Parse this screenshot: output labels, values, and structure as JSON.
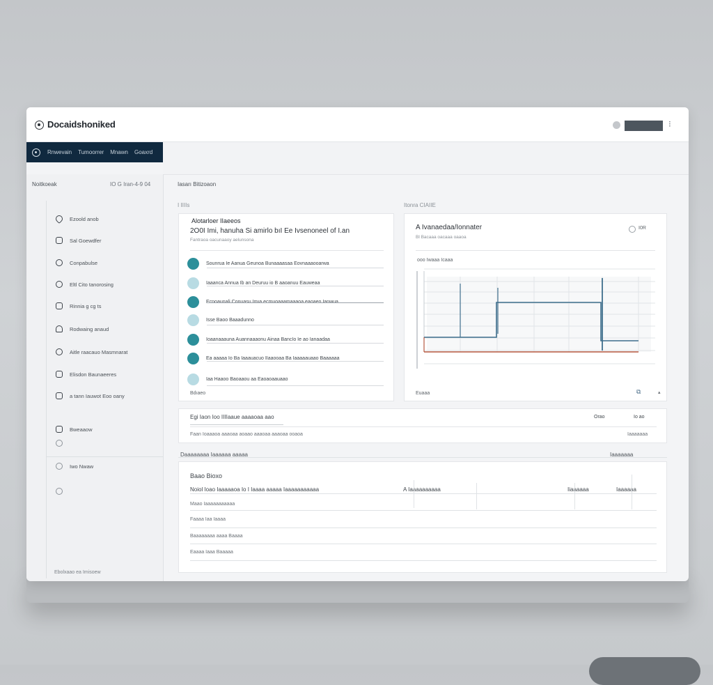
{
  "app": {
    "title": "Docaidshoniked",
    "menu_glyph": "⁝"
  },
  "nav": {
    "tabs": [
      "Rnwevain",
      "Tumoorrer",
      "Mnawn",
      "Goaxrd"
    ]
  },
  "sidebar": {
    "header": "Noitkoeak",
    "header_meta": "IO G  Iran-4-9 04",
    "items": [
      {
        "label": "Ezoold anob",
        "icon": "heart-icon"
      },
      {
        "label": "Sal Goewdfer",
        "icon": "card-icon"
      },
      {
        "label": "Conpabulse",
        "icon": "gear-icon"
      },
      {
        "label": "Eltl Cito tanorosing",
        "icon": "circle-icon"
      },
      {
        "label": "Rinnia g cg ts",
        "icon": "pin-icon"
      },
      {
        "label": "Rodwaing anaud",
        "icon": "user-icon"
      },
      {
        "label": "Aitle raacauo Masmnarat",
        "icon": "link-icon"
      },
      {
        "label": "Elisdon Baunaeeres",
        "icon": "doc-icon"
      },
      {
        "label": "a tann  Iauwot Eoo oany",
        "icon": "folder-icon"
      }
    ],
    "bottom_items": [
      {
        "label": "Bweaaow",
        "icon": "mail-icon"
      },
      {
        "label": "",
        "icon": "globe-icon"
      },
      {
        "label": "Iwo Nwaw",
        "icon": "clock-icon"
      },
      {
        "label": "",
        "icon": "settings-icon"
      }
    ],
    "footer": "Ebolxaao ea  Imisoew"
  },
  "main": {
    "title": "Iasarı Bitizoaon",
    "left_section_label": "I IIIIs",
    "right_section_label": "Itonra CIAIIE",
    "activity_card": {
      "title": "Alotarloer IIaeeos",
      "subtitle": "2O0I Imi, hanuha Si amirlo bıI Ee Ivsenoneel of I.an",
      "meta": "Fantraoa oacunaaoy aelunsona",
      "items": [
        {
          "text": "Sounrua Ie  Aanua Geunoa Bunaaaasaa Eovnaaaooarwa",
          "light": false
        },
        {
          "text": "Iaaanca Annua Ib an Deuruu io B aaoanuu Eauweaa",
          "light": true
        },
        {
          "text": "Ecnoaunali Conuasu Imıa ecmuoaaamaaaoa eaoaeo Ianwua",
          "light": false
        },
        {
          "text": "Isse Baoo  Baaadunno",
          "light": true
        },
        {
          "text": "Ioaanaaauna Auannaaaonu Ainaa BancIo Ie ao Ianaadaa",
          "light": false
        },
        {
          "text": "Ea aaaaa Io Ba Iaaauacuo IIaaooaa Ba Iaaaaauaao Baaaaaa",
          "light": false
        },
        {
          "text": "Iaa Haaoo Baoaaou aa Eaoaoaauaao",
          "light": true
        }
      ],
      "footer": "Bdıaeo"
    },
    "chart_card": {
      "title": "A Ivanaedaa/Ionnater",
      "meta": "Bl Bacaaa oacaaa oaaoa",
      "legend": "I0R",
      "chart_label": "ooo  Iwaaa Icaaa",
      "footer": "Euaaa"
    },
    "summary_card": {
      "title": "Egi Iaon Ioo IIIIaaue aaaaoaa aao",
      "col1": "Orao",
      "col2": "Io ao",
      "subline": "Faan Ioaaaoa aaaoaa aoaao aaaoaa aaaoaa ooaoa",
      "right": "Iaaaaaaa"
    },
    "table_section": {
      "label": "Daaaaaaaa Iaaaaaa aaaaa",
      "right_label": "Iaaaaaaa",
      "card_title": "Baao Bioxo",
      "headers": [
        "Noiol  Ioao Iaaaaaoa Io I  Iaaaa aaaaa Iaaaaaaaaaaa",
        "A  Iaaaaaaaaaa",
        "Iiaaaaaa",
        "Iaaaaaa"
      ],
      "rows": [
        "Maao Iaaaaaaaaaaa",
        "Faaaa Iaa Iaaaa",
        "Baaaaaaaa aaaa Baaaa",
        "Eaaaa Iaaa Baaaaa"
      ]
    }
  },
  "colors": {
    "nav_bg": "#10293f",
    "accent_teal": "#2c8f9a",
    "chart_blue": "#3e6e8c",
    "chart_red": "#b5573e"
  }
}
